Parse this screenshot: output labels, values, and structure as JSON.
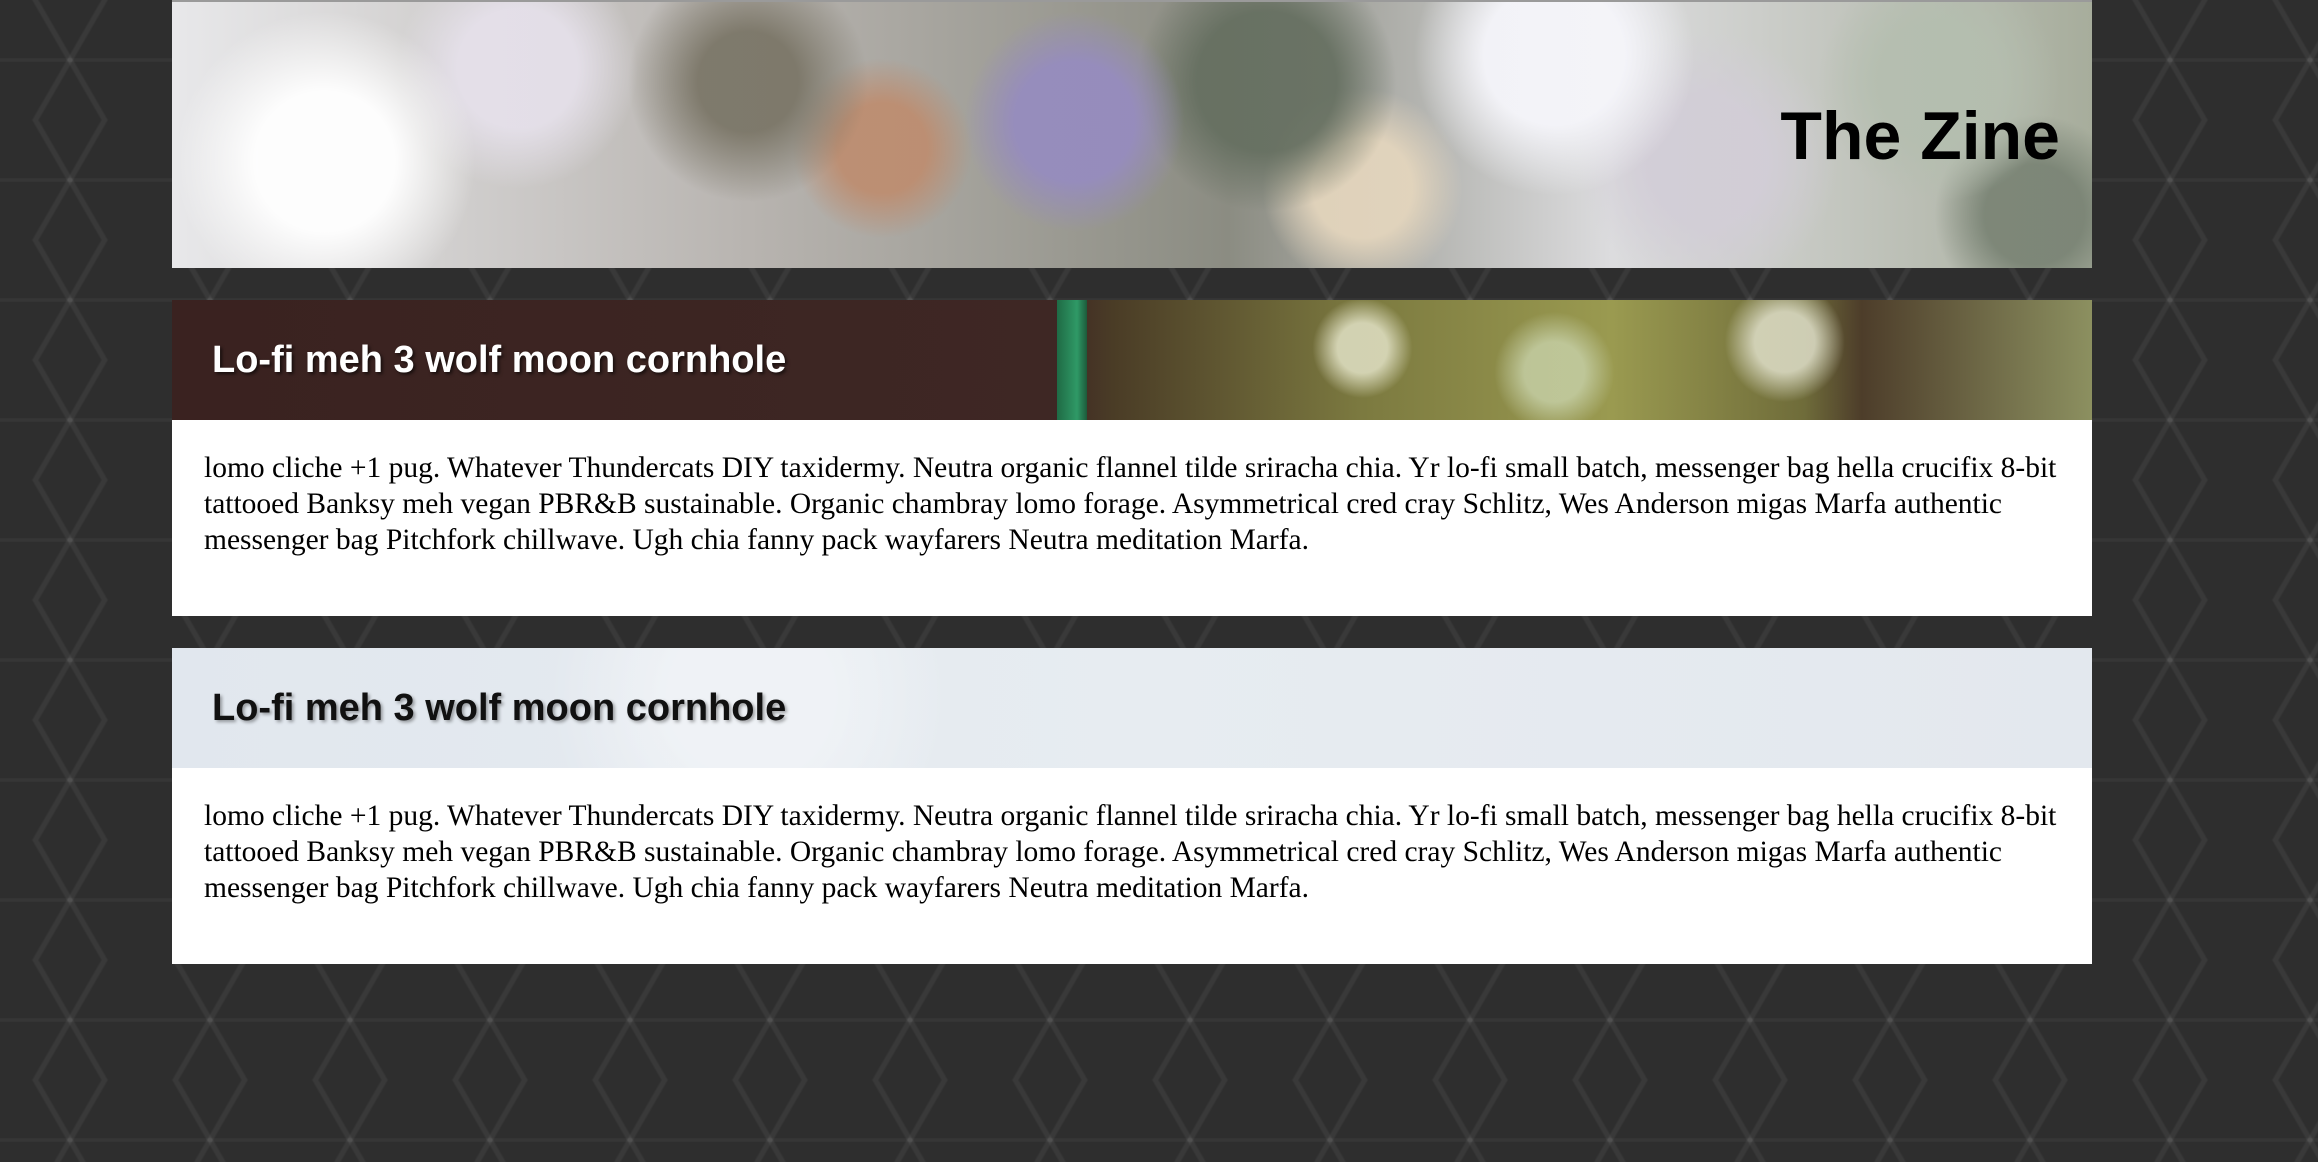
{
  "header": {
    "title": "The Zine"
  },
  "articles": [
    {
      "title": "Lo-fi meh 3 wolf moon cornhole",
      "body": "lomo cliche +1 pug. Whatever Thundercats DIY taxidermy. Neutra organic flannel tilde sriracha chia. Yr lo-fi small batch, messenger bag hella crucifix 8-bit tattooed Banksy meh vegan PBR&B sustainable. Organic chambray lomo forage. Asymmetrical cred cray Schlitz, Wes Anderson migas Marfa authentic messenger bag Pitchfork chillwave. Ugh chia fanny pack wayfarers Neutra meditation Marfa."
    },
    {
      "title": "Lo-fi meh 3 wolf moon cornhole",
      "body": "lomo cliche +1 pug. Whatever Thundercats DIY taxidermy. Neutra organic flannel tilde sriracha chia. Yr lo-fi small batch, messenger bag hella crucifix 8-bit tattooed Banksy meh vegan PBR&B sustainable. Organic chambray lomo forage. Asymmetrical cred cray Schlitz, Wes Anderson migas Marfa authentic messenger bag Pitchfork chillwave. Ugh chia fanny pack wayfarers Neutra meditation Marfa."
    }
  ]
}
